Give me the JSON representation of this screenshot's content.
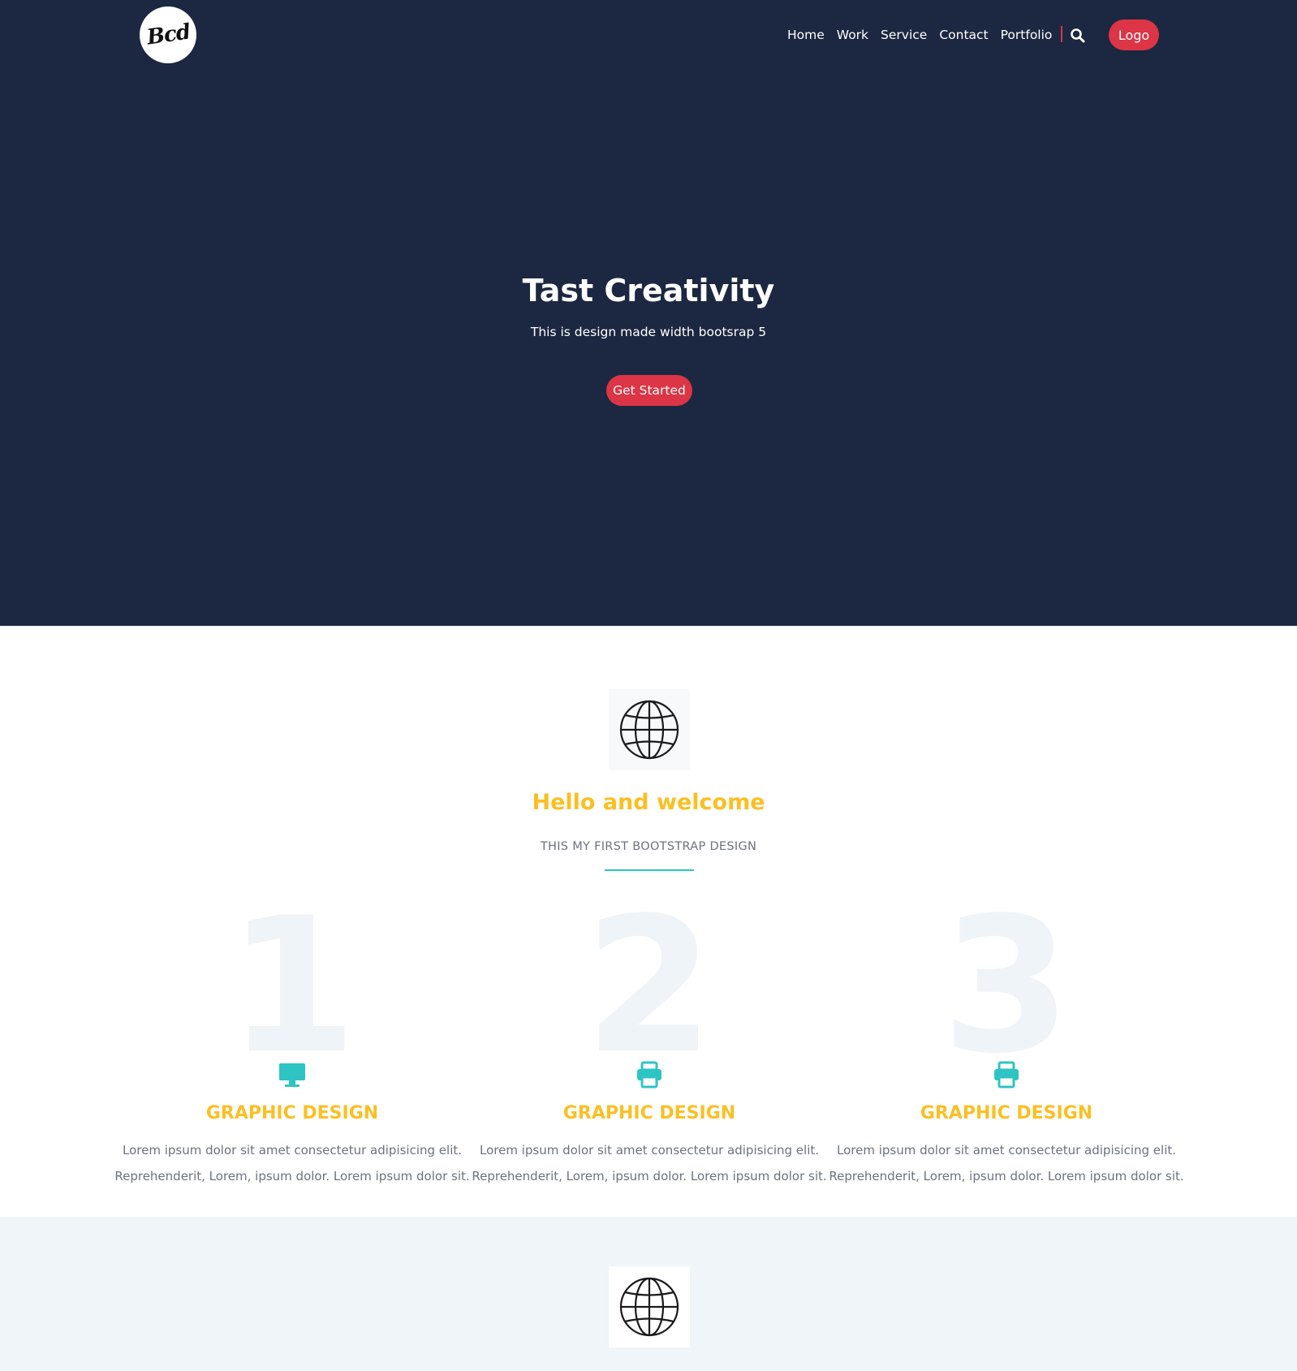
{
  "nav": {
    "brand_text": "Bcd",
    "links": [
      "Home",
      "Work",
      "Service",
      "Contact",
      "Portfolio"
    ],
    "search_icon": "search-icon",
    "logo_button": "Logo"
  },
  "hero": {
    "title": "Tast Creativity",
    "subtitle": "This is design made width bootsrap 5",
    "cta": "Get Started"
  },
  "about": {
    "icon": "globe-icon",
    "title": "Hello and welcome",
    "subtitle": "THIS MY FIRST BOOTSTRAP DESIGN"
  },
  "features": [
    {
      "number": "1",
      "icon": "desktop-icon",
      "title": "GRAPHIC DESIGN",
      "line1": "Lorem ipsum dolor sit amet consectetur adipisicing elit.",
      "line2": "Reprehenderit, Lorem, ipsum dolor. Lorem ipsum dolor sit."
    },
    {
      "number": "2",
      "icon": "printer-icon",
      "title": "GRAPHIC DESIGN",
      "line1": "Lorem ipsum dolor sit amet consectetur adipisicing elit.",
      "line2": "Reprehenderit, Lorem, ipsum dolor. Lorem ipsum dolor sit."
    },
    {
      "number": "3",
      "icon": "printer-icon",
      "title": "GRAPHIC DESIGN",
      "line1": "Lorem ipsum dolor sit amet consectetur adipisicing elit.",
      "line2": "Reprehenderit, Lorem, ipsum dolor. Lorem ipsum dolor sit."
    }
  ],
  "next_section": {
    "icon": "globe-icon"
  },
  "colors": {
    "hero_bg": "#1c2841",
    "accent_red": "#dc3545",
    "accent_yellow": "#fbbf24",
    "accent_teal": "#2ec4c4",
    "muted_text": "#6b7280",
    "light_section_bg": "#eff5f9"
  }
}
